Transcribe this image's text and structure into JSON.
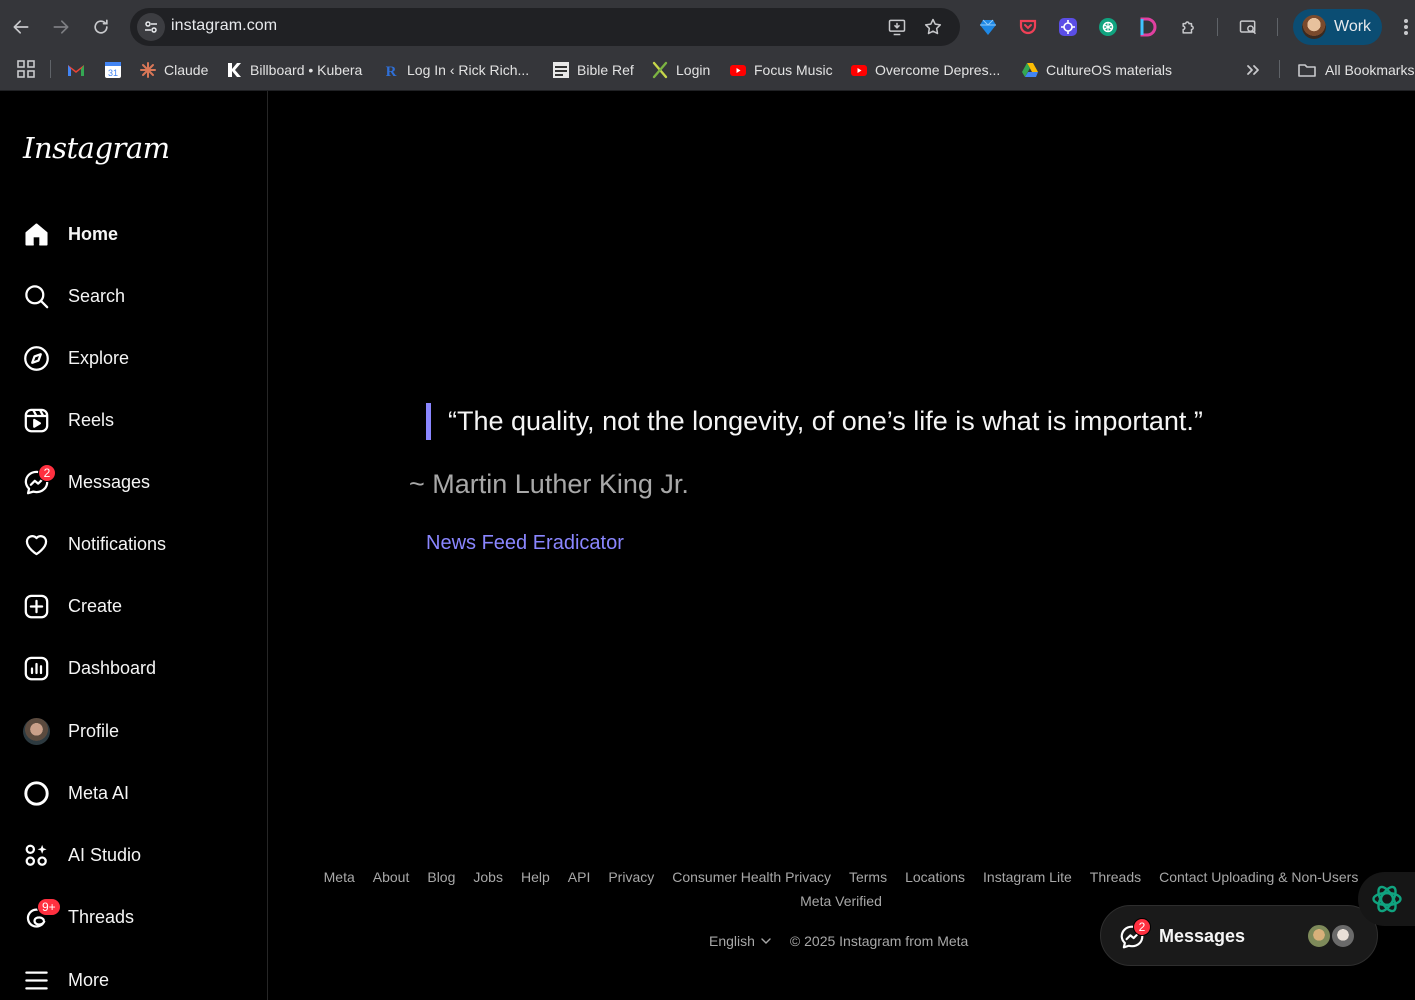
{
  "browser": {
    "url": "instagram.com",
    "profile_label": "Work",
    "bookmarks": [
      {
        "label": "",
        "icon": "gmail-icon"
      },
      {
        "label": "",
        "icon": "calendar-icon"
      },
      {
        "label": "Claude",
        "icon": "claude-icon"
      },
      {
        "label": "Billboard • Kubera",
        "icon": "kubera-icon"
      },
      {
        "label": "Log In ‹ Rick Rich...",
        "icon": "rr-icon"
      },
      {
        "label": "Bible Ref",
        "icon": "bibleref-icon"
      },
      {
        "label": "Login",
        "icon": "x-logo-icon"
      },
      {
        "label": "Focus Music",
        "icon": "youtube-icon"
      },
      {
        "label": "Overcome Depres...",
        "icon": "youtube-icon"
      },
      {
        "label": "CultureOS materials",
        "icon": "google-drive-icon"
      }
    ],
    "all_bookmarks_label": "All Bookmarks"
  },
  "sidebar": {
    "logo": "Instagram",
    "items": [
      {
        "label": "Home",
        "icon": "home-icon"
      },
      {
        "label": "Search",
        "icon": "search-icon"
      },
      {
        "label": "Explore",
        "icon": "compass-icon"
      },
      {
        "label": "Reels",
        "icon": "reels-icon"
      },
      {
        "label": "Messages",
        "icon": "messenger-icon",
        "badge": "2"
      },
      {
        "label": "Notifications",
        "icon": "heart-icon"
      },
      {
        "label": "Create",
        "icon": "plus-square-icon"
      },
      {
        "label": "Dashboard",
        "icon": "dashboard-icon"
      },
      {
        "label": "Profile",
        "icon": "avatar"
      },
      {
        "label": "Meta AI",
        "icon": "meta-ai-icon"
      },
      {
        "label": "AI Studio",
        "icon": "ai-studio-icon"
      },
      {
        "label": "Threads",
        "icon": "threads-icon",
        "badge": "9+"
      },
      {
        "label": "More",
        "icon": "menu-icon"
      }
    ]
  },
  "main": {
    "quote": "“The quality, not the longevity, of one’s life is what is important.”",
    "author": "~ Martin Luther King Jr.",
    "link": "News Feed Eradicator"
  },
  "footer": {
    "links": [
      "Meta",
      "About",
      "Blog",
      "Jobs",
      "Help",
      "API",
      "Privacy",
      "Consumer Health Privacy",
      "Terms",
      "Locations",
      "Instagram Lite",
      "Threads",
      "Contact Uploading & Non-Users",
      "Meta Verified"
    ],
    "language": "English",
    "copyright": "© 2025 Instagram from Meta"
  },
  "messages_pill": {
    "label": "Messages",
    "badge": "2"
  },
  "colors": {
    "accent": "#8a86ff",
    "badge": "#ff3040",
    "background": "#000000"
  }
}
